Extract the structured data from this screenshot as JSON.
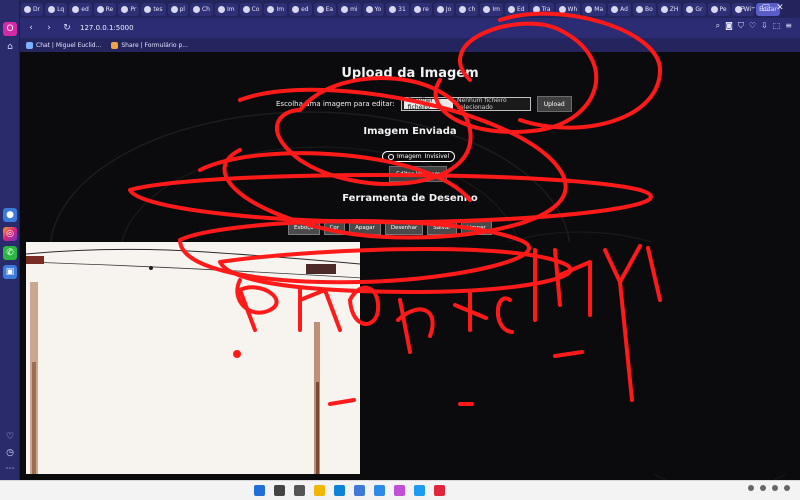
{
  "browser": {
    "tabs": [
      "Dr",
      "Lq",
      "ed",
      "Re",
      "Pr",
      "tes",
      "pl",
      "Ch",
      "Im",
      "Co",
      "Im",
      "ed",
      "Ea",
      "mi",
      "Yo",
      "31",
      "re",
      "Jo",
      "ch",
      "Im",
      "Ed",
      "Tra",
      "Wh",
      "Ma",
      "Ad",
      "Bo",
      "ZH",
      "Gr",
      "Pe",
      "Wi"
    ],
    "active_tab_label": "Editar",
    "url": "127.0.0.1:5000",
    "bookmarks": [
      {
        "label": "Chat | Miguel Euclid...",
        "icon": "chat-icon"
      },
      {
        "label": "Share | Formulário p...",
        "icon": "share-icon"
      }
    ]
  },
  "page": {
    "upload_title": "Upload da Imagem",
    "choose_label": "Escolha uma imagem para editar:",
    "choose_file_button": "Escolher ficheiro",
    "no_file_text": "Nenhum ficheiro selecionado",
    "upload_button": "Upload",
    "sent_image_title": "Imagem Enviada",
    "toggle_label": "Imagem",
    "toggle_value": "Invisivel",
    "edit_image_button": "Editar Imagem",
    "drawing_tool_title": "Ferramenta de Desenho",
    "tools": [
      "Esboço",
      "Cor",
      "Apagar",
      "Desenhar",
      "Salvar",
      "Limpar"
    ]
  },
  "taskbar": {
    "icon_names": [
      "windows-start-icon",
      "search-icon",
      "task-view-icon",
      "files-icon",
      "edge-icon",
      "store-icon",
      "mail-icon",
      "photos-icon",
      "vscode-icon",
      "opera-icon"
    ]
  },
  "colors": {
    "scribble": "#ff1a1a",
    "sidebar": "#2a2b6a",
    "tabbar": "#23245c",
    "page_bg": "#0b0b0d"
  }
}
